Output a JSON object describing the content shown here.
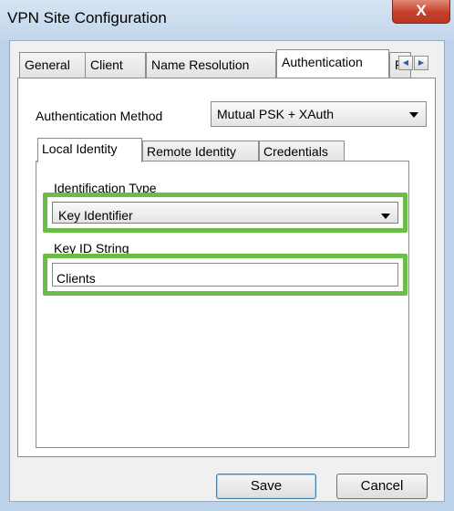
{
  "window": {
    "title": "VPN Site Configuration",
    "close_glyph": "X"
  },
  "tabs": [
    {
      "label": "General"
    },
    {
      "label": "Client"
    },
    {
      "label": "Name Resolution"
    },
    {
      "label": "Authentication",
      "active": true
    },
    {
      "label": "P"
    }
  ],
  "tab_scroll": {
    "left": "◀",
    "right": "▶"
  },
  "authentication": {
    "method_label": "Authentication Method",
    "method_value": "Mutual PSK + XAuth"
  },
  "inner_tabs": [
    {
      "label": "Local Identity",
      "active": true
    },
    {
      "label": "Remote Identity"
    },
    {
      "label": "Credentials"
    }
  ],
  "local_identity": {
    "id_type_label": "Identification Type",
    "id_type_value": "Key Identifier",
    "key_id_label": "Key ID String",
    "key_id_value": "Clients"
  },
  "buttons": {
    "save": "Save",
    "cancel": "Cancel"
  },
  "colors": {
    "highlight": "#6abd45",
    "title_bar": "#c2d6ec",
    "close_button": "#c5402c"
  }
}
